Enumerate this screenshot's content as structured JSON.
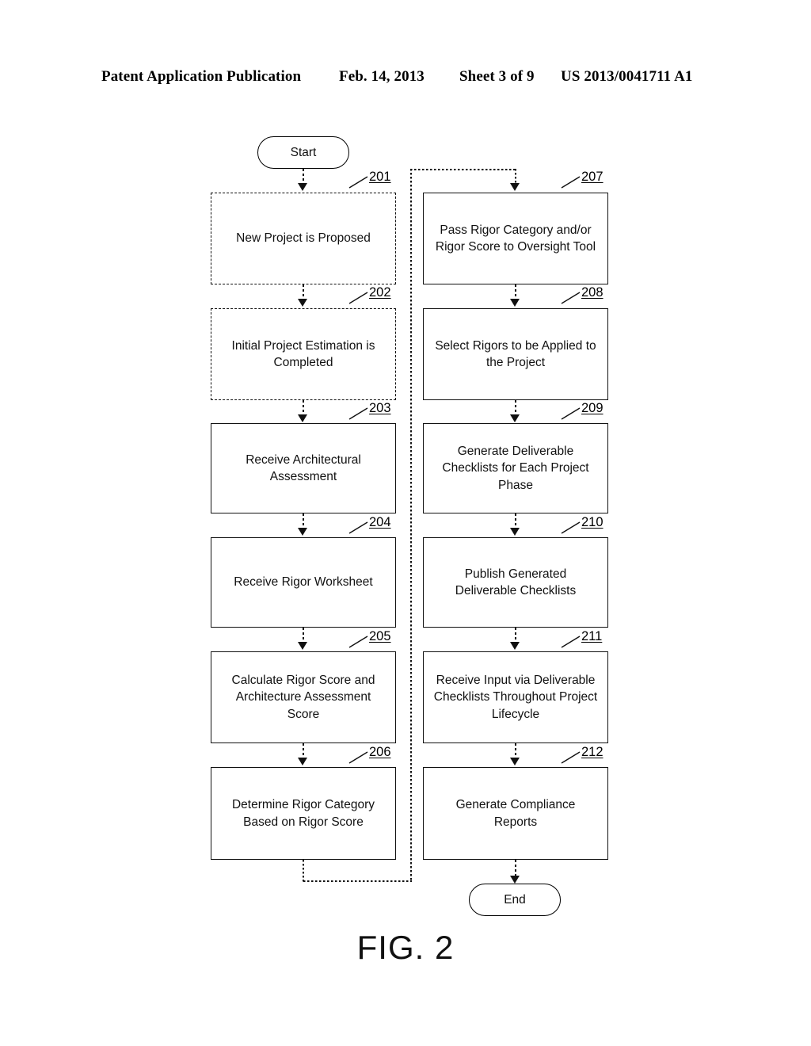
{
  "header": {
    "publication": "Patent Application Publication",
    "date": "Feb. 14, 2013",
    "sheet": "Sheet 3 of 9",
    "patent_number": "US 2013/0041711 A1"
  },
  "figure": {
    "caption": "FIG. 2",
    "start_label": "Start",
    "end_label": "End",
    "left_column": [
      {
        "ref": "201",
        "text": "New Project is Proposed",
        "border": "dashed"
      },
      {
        "ref": "202",
        "text": "Initial Project Estimation is Completed",
        "border": "dashed"
      },
      {
        "ref": "203",
        "text": "Receive Architectural Assessment",
        "border": "solid"
      },
      {
        "ref": "204",
        "text": "Receive Rigor Worksheet",
        "border": "solid"
      },
      {
        "ref": "205",
        "text": "Calculate Rigor Score and Architecture Assessment Score",
        "border": "solid"
      },
      {
        "ref": "206",
        "text": "Determine Rigor Category Based on Rigor Score",
        "border": "solid"
      }
    ],
    "right_column": [
      {
        "ref": "207",
        "text": "Pass Rigor Category and/or Rigor Score to Oversight Tool",
        "border": "solid"
      },
      {
        "ref": "208",
        "text": "Select Rigors to be Applied to the Project",
        "border": "solid"
      },
      {
        "ref": "209",
        "text": "Generate Deliverable Checklists for Each Project Phase",
        "border": "solid"
      },
      {
        "ref": "210",
        "text": "Publish Generated Deliverable Checklists",
        "border": "solid"
      },
      {
        "ref": "211",
        "text": "Receive Input via Deliverable Checklists Throughout Project Lifecycle",
        "border": "solid"
      },
      {
        "ref": "212",
        "text": "Generate Compliance Reports",
        "border": "solid"
      }
    ]
  },
  "colors": {
    "ink": "#111111",
    "paper": "#ffffff"
  }
}
